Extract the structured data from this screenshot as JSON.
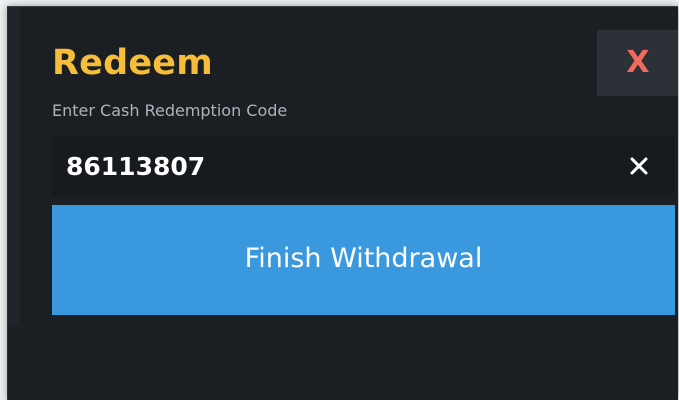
{
  "dialog": {
    "title": "Redeem",
    "subtitle": "Enter Cash Redemption Code",
    "close_label": "X",
    "code_value": "86113807",
    "finish_label": "Finish Withdrawal"
  },
  "colors": {
    "title": "#f5bd3a",
    "close": "#f26a5b",
    "primary_button": "#3a98df",
    "background": "#1b1e23"
  },
  "icons": {
    "clear": "close-icon"
  }
}
